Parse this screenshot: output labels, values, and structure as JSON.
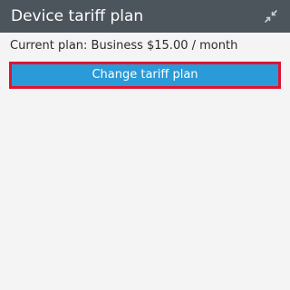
{
  "header": {
    "title": "Device tariff plan",
    "collapse_icon": "collapse-arrows-icon",
    "background_color": "#4c545c"
  },
  "main": {
    "current_plan_text": "Current plan: Business $15.00 / month",
    "change_button_label": "Change tariff plan",
    "button_color": "#2a9ad8",
    "highlight_border_color": "#e0142e"
  },
  "colors": {
    "panel_background": "#f4f4f4",
    "text": "#2b2b2b"
  }
}
